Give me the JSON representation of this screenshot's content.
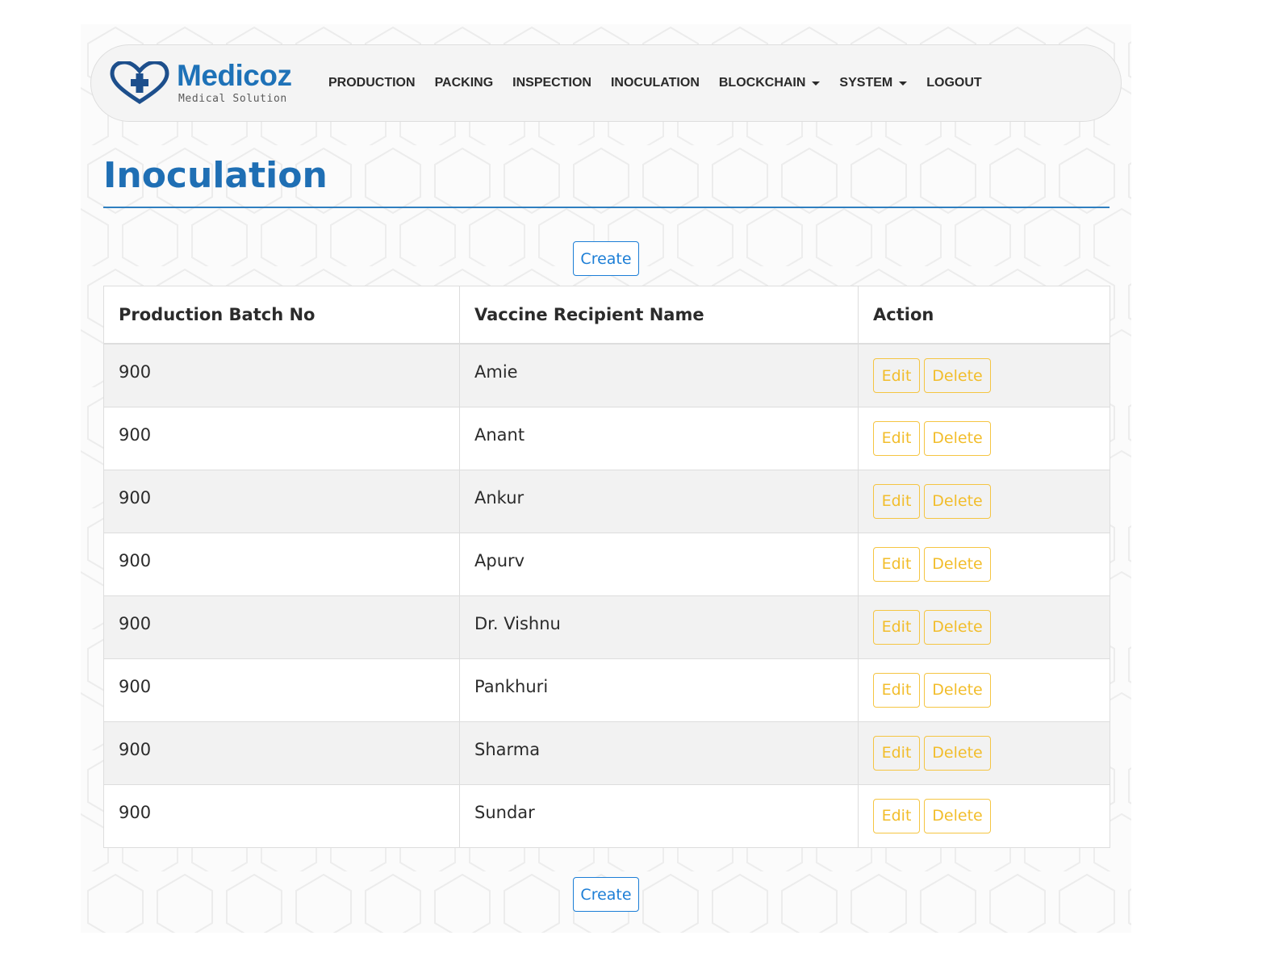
{
  "brand": {
    "name": "Medicoz",
    "tagline": "Medical Solution",
    "color": "#1e72b8"
  },
  "nav": {
    "items": [
      {
        "label": "PRODUCTION",
        "dropdown": false
      },
      {
        "label": "PACKING",
        "dropdown": false
      },
      {
        "label": "INSPECTION",
        "dropdown": false
      },
      {
        "label": "INOCULATION",
        "dropdown": false
      },
      {
        "label": "BLOCKCHAIN",
        "dropdown": true
      },
      {
        "label": "SYSTEM",
        "dropdown": true
      },
      {
        "label": "LOGOUT",
        "dropdown": false
      }
    ]
  },
  "page": {
    "title": "Inoculation",
    "create_label": "Create"
  },
  "table": {
    "headers": [
      "Production Batch No",
      "Vaccine Recipient Name",
      "Action"
    ],
    "edit_label": "Edit",
    "delete_label": "Delete",
    "rows": [
      {
        "batch": "900",
        "name": "Amie"
      },
      {
        "batch": "900",
        "name": "Anant"
      },
      {
        "batch": "900",
        "name": "Ankur"
      },
      {
        "batch": "900",
        "name": "Apurv"
      },
      {
        "batch": "900",
        "name": "Dr. Vishnu"
      },
      {
        "batch": "900",
        "name": "Pankhuri"
      },
      {
        "batch": "900",
        "name": "Sharma"
      },
      {
        "batch": "900",
        "name": "Sundar"
      }
    ]
  },
  "colors": {
    "accent": "#1f6fb4",
    "primary_button": "#1c7ed6",
    "warning_button": "#f2bd2b"
  }
}
